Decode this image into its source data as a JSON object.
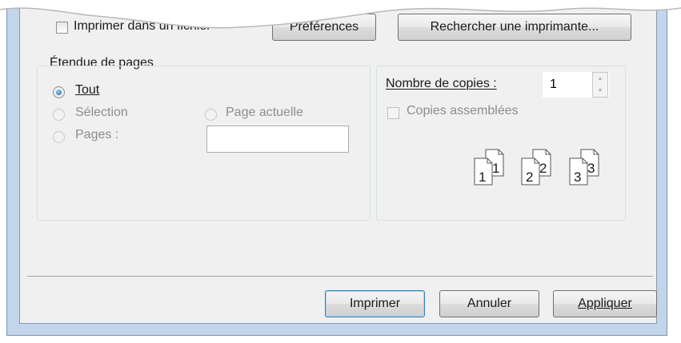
{
  "top": {
    "print_to_file_label": "Imprimer dans un fichier",
    "preferences_label": "Préférences",
    "find_printer_label": "Rechercher une imprimante..."
  },
  "page_range": {
    "title": "Étendue de pages",
    "all_label": "Tout",
    "selection_label": "Sélection",
    "current_page_label": "Page actuelle",
    "pages_label": "Pages :",
    "pages_value": ""
  },
  "copies": {
    "count_label": "Nombre de copies :",
    "count_value": "1",
    "collate_label": "Copies assemblées",
    "collate_icons": [
      {
        "front": "1",
        "back": "1"
      },
      {
        "front": "2",
        "back": "2"
      },
      {
        "front": "3",
        "back": "3"
      }
    ]
  },
  "footer": {
    "print_label": "Imprimer",
    "cancel_label": "Annuler",
    "apply_label": "Appliquer"
  }
}
